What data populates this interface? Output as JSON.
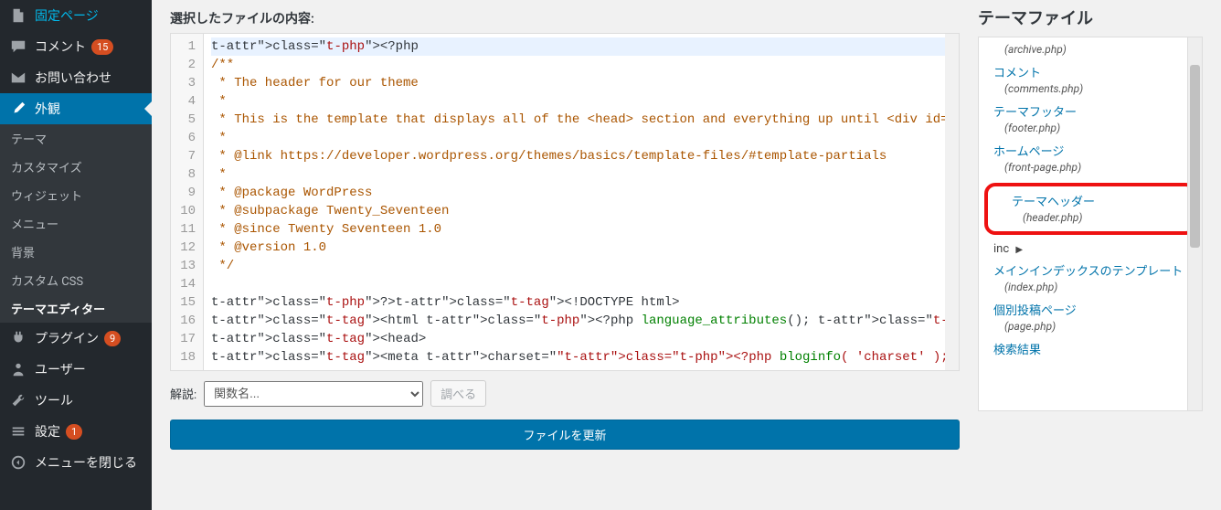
{
  "sidebar": {
    "items": [
      {
        "label": "固定ページ"
      },
      {
        "label": "コメント",
        "badge": "15"
      },
      {
        "label": "お問い合わせ"
      },
      {
        "label": "外観",
        "active": true
      },
      {
        "label": "プラグイン",
        "badge": "9"
      },
      {
        "label": "ユーザー"
      },
      {
        "label": "ツール"
      },
      {
        "label": "設定",
        "badge": "1"
      },
      {
        "label": "メニューを閉じる"
      }
    ],
    "submenu": [
      {
        "label": "テーマ"
      },
      {
        "label": "カスタマイズ"
      },
      {
        "label": "ウィジェット"
      },
      {
        "label": "メニュー"
      },
      {
        "label": "背景"
      },
      {
        "label": "カスタム CSS"
      },
      {
        "label": "テーマエディター",
        "current": true
      }
    ]
  },
  "editor": {
    "title": "選択したファイルの内容:",
    "lines": [
      "<?php",
      "/**",
      " * The header for our theme",
      " *",
      " * This is the template that displays all of the <head> section and everything up until <div id=\"content\">",
      " *",
      " * @link https://developer.wordpress.org/themes/basics/template-files/#template-partials",
      " *",
      " * @package WordPress",
      " * @subpackage Twenty_Seventeen",
      " * @since Twenty Seventeen 1.0",
      " * @version 1.0",
      " */",
      "",
      "?><!DOCTYPE html>",
      "<html <?php language_attributes(); ?> class=\"no-js no-svg\">",
      "<head>",
      "<meta charset=\"<?php bloginfo( 'charset' ); ?>\">"
    ],
    "doc_label": "解説:",
    "doc_placeholder": "関数名...",
    "lookup_btn": "調べる",
    "update_btn": "ファイルを更新"
  },
  "files": {
    "heading": "テーマファイル",
    "list": [
      {
        "fn": "(archive.php)"
      },
      {
        "name": "コメント",
        "fn": "(comments.php)"
      },
      {
        "name": "テーマフッター",
        "fn": "(footer.php)"
      },
      {
        "name": "ホームページ",
        "fn": "(front-page.php)"
      },
      {
        "name": "テーマヘッダー",
        "fn": "(header.php)",
        "highlighted": true
      },
      {
        "inc": "inc"
      },
      {
        "name": "メインインデックスのテンプレート",
        "fn": "(index.php)"
      },
      {
        "name": "個別投稿ページ",
        "fn": "(page.php)"
      },
      {
        "name": "検索結果"
      }
    ]
  }
}
